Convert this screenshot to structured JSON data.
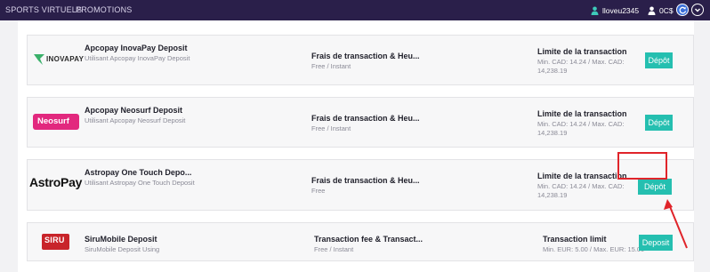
{
  "topbar": {
    "nav": [
      "SPORTS VIRTUELS",
      "PROMOTIONS"
    ],
    "username": "lloveu2345",
    "balance": "0C$"
  },
  "methods": [
    {
      "logo_text": "INOVAPAY",
      "title": "Apcopay InovaPay Deposit",
      "subtitle": "Utilisant Apcopay InovaPay Deposit",
      "fee_header": "Frais de transaction & Heu...",
      "fee_value": "Free / Instant",
      "limit_header": "Limite de la transaction",
      "limit_value": "Min. CAD: 14.24 / Max. CAD: 14,238.19",
      "button": "Dépôt"
    },
    {
      "logo_text": "Neosurf",
      "title": "Apcopay Neosurf Deposit",
      "subtitle": "Utilisant Apcopay Neosurf Deposit",
      "fee_header": "Frais de transaction & Heu...",
      "fee_value": "Free / Instant",
      "limit_header": "Limite de la transaction",
      "limit_value": "Min. CAD: 14.24 / Max. CAD: 14,238.19",
      "button": "Dépôt"
    },
    {
      "logo_text": "AstroPay",
      "title": "Astropay One Touch Depo...",
      "subtitle": "Utilisant Astropay One Touch Deposit",
      "fee_header": "Frais de transaction & Heu...",
      "fee_value": "Free",
      "limit_header": "Limite de la transaction",
      "limit_value": "Min. CAD: 14.24 / Max. CAD: 14,238.19",
      "button": "Dépôt"
    },
    {
      "logo_text": "SIRU",
      "title": "SiruMobile Deposit",
      "subtitle": "SiruMobile Deposit Using",
      "fee_header": "Transaction fee & Transact...",
      "fee_value": "Free / Instant",
      "limit_header": "Transaction limit",
      "limit_value": "Min. EUR: 5.00 / Max. EUR: 15.00",
      "button": "Deposit"
    }
  ],
  "colors": {
    "topbar": "#2a1f4a",
    "button": "#25bfb0",
    "highlight": "#e0242a"
  }
}
